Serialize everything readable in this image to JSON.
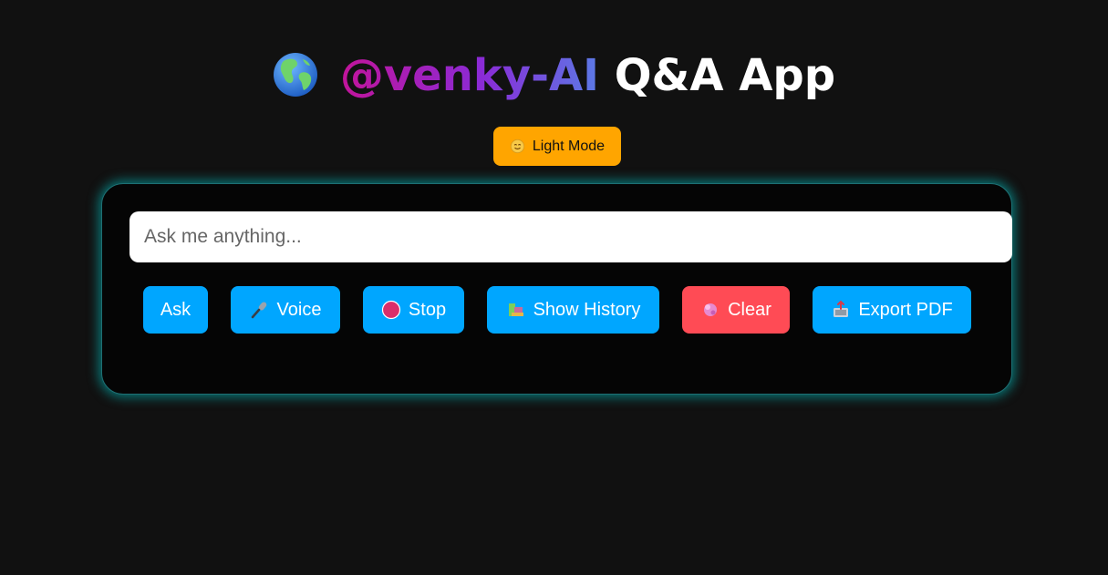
{
  "header": {
    "globe_icon": "globe-icon",
    "brand": "@venky-AI",
    "title_rest": " Q&A App"
  },
  "theme_toggle": {
    "icon": "sun-face-icon",
    "label": "Light Mode"
  },
  "question": {
    "placeholder": "Ask me anything...",
    "value": ""
  },
  "actions": {
    "ask": "Ask",
    "voice": "Voice",
    "stop": "Stop",
    "history": "Show History",
    "clear": "Clear",
    "export": "Export PDF"
  },
  "icons": {
    "voice": "microphone-icon",
    "stop": "stop-circle-icon",
    "history": "books-icon",
    "clear": "sparkle-icon",
    "export": "outbox-icon"
  },
  "colors": {
    "background": "#111111",
    "card": "#050505",
    "card_glow": "#00c8c8",
    "button": "#00a6ff",
    "clear_button": "#ff4b55",
    "toggle": "#ffa500",
    "brand_gradient_start": "#c2149a",
    "brand_gradient_end": "#5b7ae6"
  }
}
